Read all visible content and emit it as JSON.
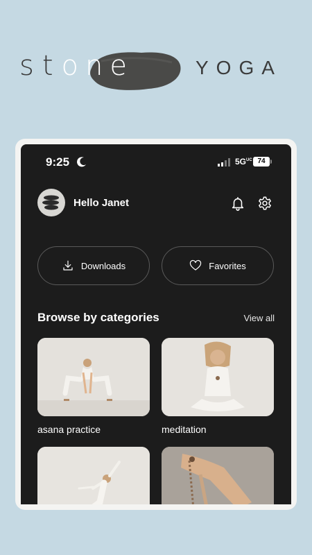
{
  "brand": {
    "prefix": "st",
    "middle": "one",
    "suffix": "YOGA"
  },
  "status_bar": {
    "time": "9:25",
    "network": "5G",
    "network_sup": "UC",
    "battery": "74"
  },
  "header": {
    "greeting": "Hello Janet"
  },
  "actions": {
    "downloads_label": "Downloads",
    "favorites_label": "Favorites"
  },
  "categories": {
    "title": "Browse by categories",
    "view_all_label": "View all",
    "items": [
      {
        "label": "asana practice"
      },
      {
        "label": "meditation"
      },
      {
        "label": ""
      },
      {
        "label": ""
      }
    ]
  },
  "colors": {
    "background": "#c5d9e3",
    "screen": "#1c1c1c",
    "frame": "#f4f4f2"
  }
}
